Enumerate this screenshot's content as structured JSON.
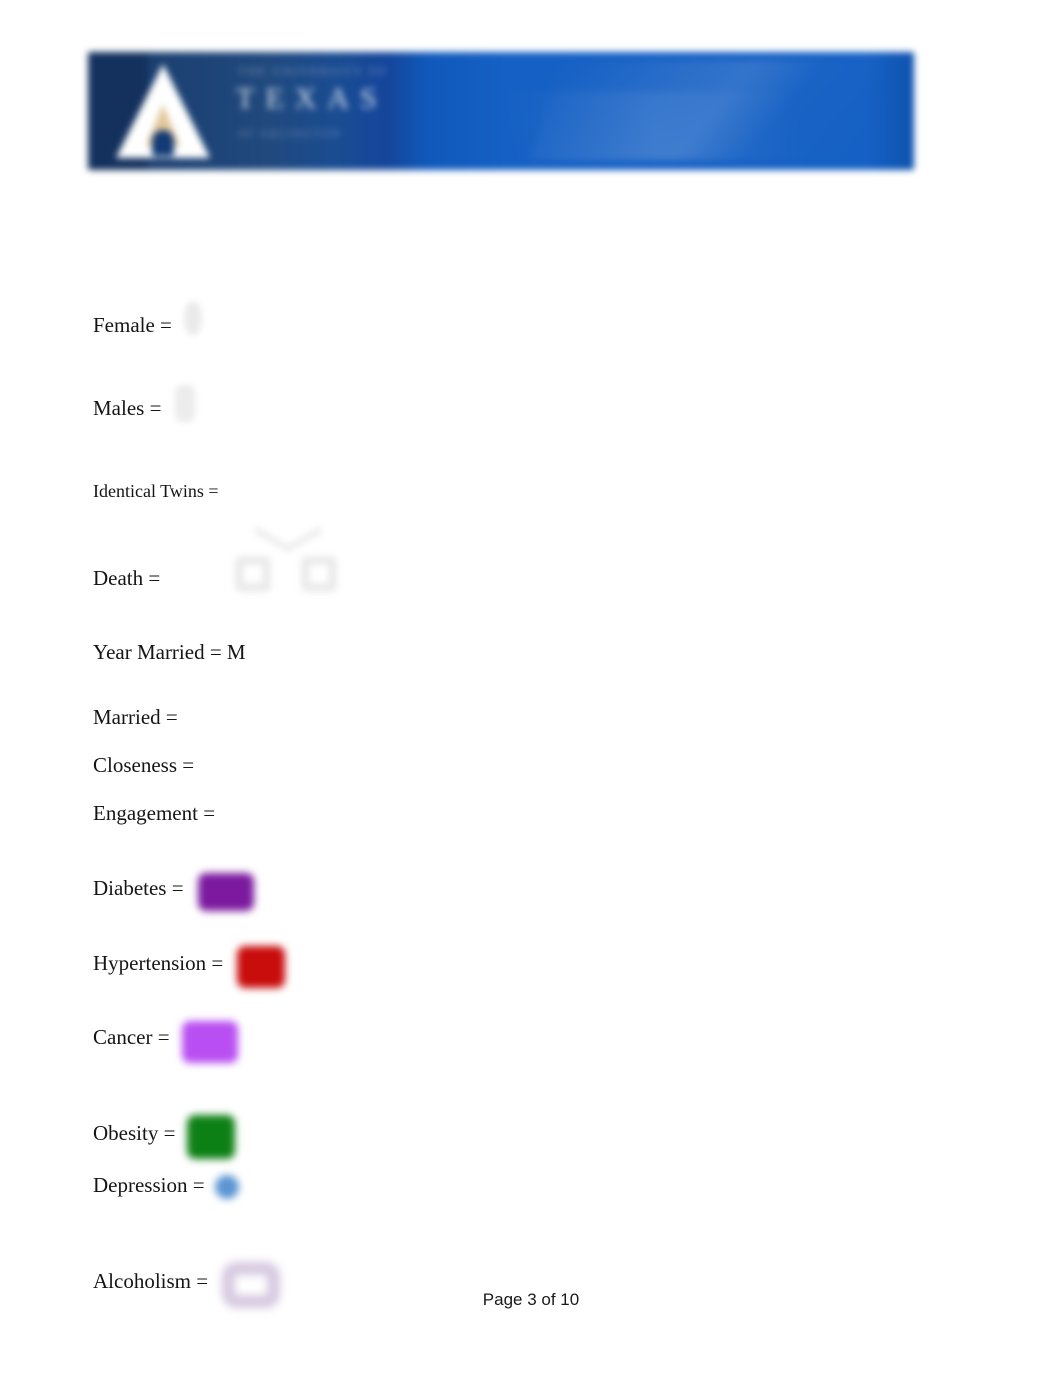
{
  "document": {
    "page_footer": "Page 3 of 10"
  },
  "header": {
    "institution_top": "THE UNIVERSITY OF",
    "wordmark": "TEXAS",
    "institution_sub": "AT ARLINGTON",
    "logo_icon": "ut-a-flame-logo-icon",
    "banner_color": "#1560C4",
    "banner_dark_color": "#14315E"
  },
  "legend": {
    "items": [
      {
        "label": "Female =",
        "symbol": "circle-outline",
        "symbol_name": "female-circle-symbol",
        "color": "#E9E9E9"
      },
      {
        "label": "Males =",
        "symbol": "square-outline",
        "symbol_name": "male-square-symbol",
        "color": "#EBEBEB"
      },
      {
        "label": "Identical Twins =",
        "symbol": "twin-fork-with-two-squares",
        "symbol_name": "identical-twins-symbol",
        "color": "#EAEAEA"
      },
      {
        "label": "Death =",
        "symbol": "x-cross",
        "symbol_name": "death-cross-symbol",
        "color": "#E8E8E8"
      },
      {
        "label": "Year Married = M",
        "symbol": "text-only",
        "symbol_name": "year-married-text",
        "color": "#151515"
      },
      {
        "label": "Married =",
        "symbol": "horizontal-line",
        "symbol_name": "married-line-symbol",
        "color": "#ECECEE"
      },
      {
        "label": "Closeness =",
        "symbol": "horizontal-line",
        "symbol_name": "closeness-line-symbol",
        "color": "#9BCCA2"
      },
      {
        "label": "Engagement =",
        "symbol": "horizontal-dashed-line",
        "symbol_name": "engagement-line-symbol",
        "color": "#DCDCE8"
      },
      {
        "label": "Diabetes =",
        "symbol": "filled-swatch",
        "symbol_name": "diabetes-color-swatch",
        "color": "#7B1A9E"
      },
      {
        "label": "Hypertension =",
        "symbol": "filled-swatch",
        "symbol_name": "hypertension-color-swatch",
        "color": "#C90C0C"
      },
      {
        "label": "Cancer =",
        "symbol": "filled-swatch",
        "symbol_name": "cancer-color-swatch",
        "color": "#B94FF2"
      },
      {
        "label": "Obesity =",
        "symbol": "filled-swatch",
        "symbol_name": "obesity-color-swatch",
        "color": "#0D8015"
      },
      {
        "label": "Depression =",
        "symbol": "filled-dot",
        "symbol_name": "depression-color-dot",
        "color": "#5B95D2"
      },
      {
        "label": "Alcoholism =",
        "symbol": "outlined-rounded-rect",
        "symbol_name": "alcoholism-outline-swatch",
        "color": "#D6C9E0"
      }
    ]
  }
}
